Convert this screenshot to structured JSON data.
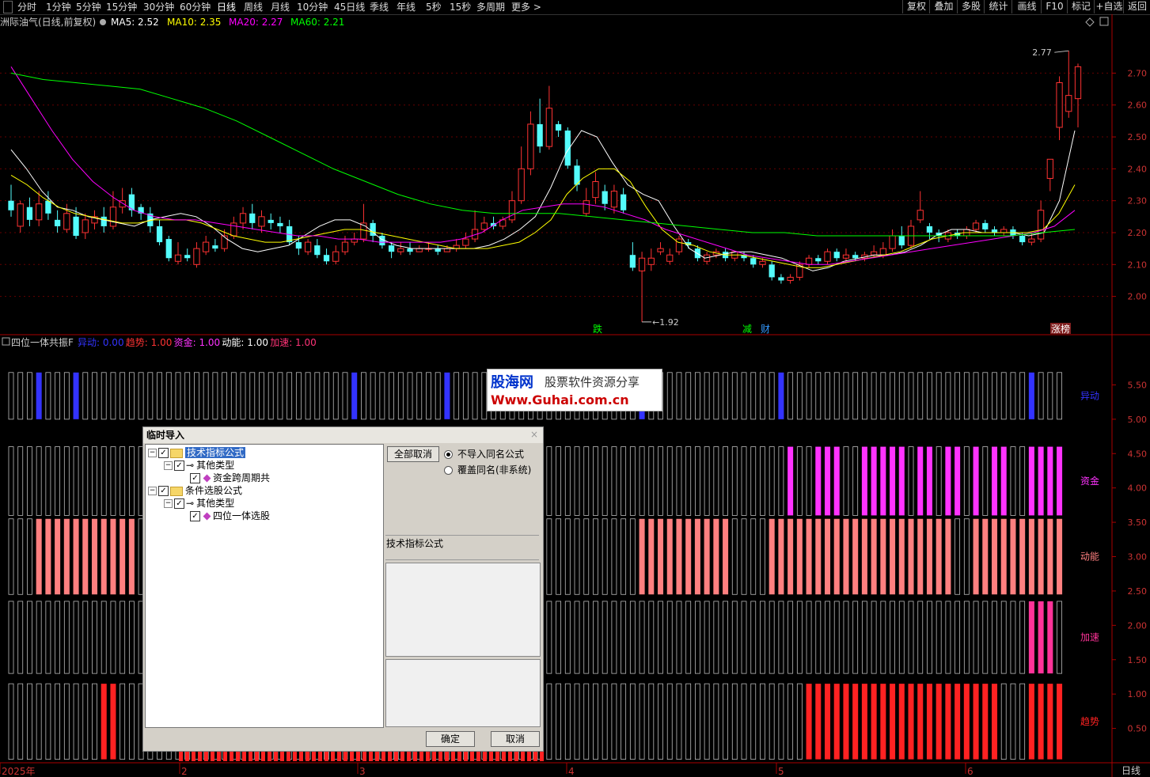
{
  "toolbar": {
    "periods": [
      "分时",
      "1分钟",
      "5分钟",
      "15分钟",
      "30分钟",
      "60分钟",
      "日线",
      "周线",
      "月线",
      "10分钟",
      "45日线",
      "季线",
      "年线",
      "5秒",
      "15秒",
      "多周期",
      "更多 >"
    ],
    "active_period": "日线",
    "right_buttons": [
      "复权",
      "叠加",
      "多股",
      "统计",
      "画线",
      "F10",
      "标记",
      "+自选",
      "返回"
    ]
  },
  "main_chart": {
    "title": "洲际油气(日线,前复权)",
    "ma_legend": [
      {
        "label": "MA5: 2.52",
        "color": "#ffffff"
      },
      {
        "label": "MA10: 2.35",
        "color": "#ffff00"
      },
      {
        "label": "MA20: 2.27",
        "color": "#ff00ff"
      },
      {
        "label": "MA60: 2.21",
        "color": "#00ff00"
      }
    ],
    "high_label": "2.77",
    "low_label": "1.92",
    "markers": [
      {
        "text": "跌",
        "color": "#00ff00"
      },
      {
        "text": "减",
        "color": "#00ff00"
      },
      {
        "text": "财",
        "color": "#3399ff"
      },
      {
        "text": "涨榜",
        "color": "#ffffff"
      }
    ]
  },
  "indicator_panel": {
    "title": "四位一体共振F",
    "legend": [
      {
        "label": "异动: 0.00",
        "color": "#3333ff"
      },
      {
        "label": "趋势: 1.00",
        "color": "#ff3333"
      },
      {
        "label": "资金: 1.00",
        "color": "#ff33ff"
      },
      {
        "label": "动能: 1.00",
        "color": "#ffffff"
      },
      {
        "label": "加速: 1.00",
        "color": "#ff3377"
      }
    ],
    "band_labels": [
      "异动",
      "资金",
      "动能",
      "加速",
      "趋势"
    ],
    "band_colors": [
      "#3333ff",
      "#ff33ff",
      "#ff8080",
      "#ff3399",
      "#ff2222"
    ]
  },
  "x_axis": {
    "labels": [
      "2025年",
      "2",
      "3",
      "4",
      "5",
      "6"
    ],
    "period_label": "日线"
  },
  "chart_data": {
    "type": "candlestick",
    "price_axis": {
      "ticks": [
        "2.70",
        "2.60",
        "2.50",
        "2.40",
        "2.30",
        "2.20",
        "2.10",
        "2.00"
      ],
      "ylim": [
        1.88,
        2.83
      ]
    },
    "indicator_axis": {
      "ticks": [
        "5.50",
        "5.00",
        "4.50",
        "4.00",
        "3.50",
        "3.00",
        "2.50",
        "2.00",
        "1.50",
        "1.00",
        "0.50"
      ],
      "ylim": [
        0,
        6.0
      ]
    },
    "candles": [
      [
        2.3,
        2.27,
        2.35,
        2.25
      ],
      [
        2.22,
        2.29,
        2.3,
        2.2
      ],
      [
        2.28,
        2.24,
        2.31,
        2.22
      ],
      [
        2.24,
        2.29,
        2.33,
        2.22
      ],
      [
        2.3,
        2.26,
        2.33,
        2.24
      ],
      [
        2.24,
        2.22,
        2.27,
        2.2
      ],
      [
        2.21,
        2.26,
        2.29,
        2.2
      ],
      [
        2.25,
        2.19,
        2.28,
        2.18
      ],
      [
        2.2,
        2.24,
        2.26,
        2.18
      ],
      [
        2.23,
        2.25,
        2.27,
        2.21
      ],
      [
        2.25,
        2.22,
        2.28,
        2.2
      ],
      [
        2.22,
        2.28,
        2.33,
        2.21
      ],
      [
        2.28,
        2.3,
        2.34,
        2.26
      ],
      [
        2.32,
        2.27,
        2.34,
        2.25
      ],
      [
        2.28,
        2.26,
        2.29,
        2.24
      ],
      [
        2.26,
        2.22,
        2.28,
        2.2
      ],
      [
        2.22,
        2.17,
        2.24,
        2.16
      ],
      [
        2.18,
        2.12,
        2.19,
        2.11
      ],
      [
        2.11,
        2.13,
        2.17,
        2.1
      ],
      [
        2.13,
        2.12,
        2.15,
        2.11
      ],
      [
        2.1,
        2.15,
        2.17,
        2.09
      ],
      [
        2.14,
        2.17,
        2.19,
        2.13
      ],
      [
        2.16,
        2.15,
        2.18,
        2.14
      ],
      [
        2.15,
        2.19,
        2.21,
        2.14
      ],
      [
        2.19,
        2.23,
        2.25,
        2.18
      ],
      [
        2.23,
        2.26,
        2.28,
        2.21
      ],
      [
        2.26,
        2.23,
        2.29,
        2.21
      ],
      [
        2.22,
        2.25,
        2.27,
        2.2
      ],
      [
        2.24,
        2.23,
        2.26,
        2.21
      ],
      [
        2.23,
        2.22,
        2.25,
        2.2
      ],
      [
        2.22,
        2.17,
        2.24,
        2.16
      ],
      [
        2.17,
        2.15,
        2.19,
        2.13
      ],
      [
        2.14,
        2.17,
        2.18,
        2.13
      ],
      [
        2.16,
        2.13,
        2.18,
        2.12
      ],
      [
        2.13,
        2.11,
        2.15,
        2.1
      ],
      [
        2.11,
        2.14,
        2.16,
        2.1
      ],
      [
        2.14,
        2.17,
        2.19,
        2.13
      ],
      [
        2.17,
        2.18,
        2.2,
        2.16
      ],
      [
        2.18,
        2.23,
        2.29,
        2.17
      ],
      [
        2.23,
        2.19,
        2.24,
        2.17
      ],
      [
        2.19,
        2.16,
        2.2,
        2.15
      ],
      [
        2.16,
        2.14,
        2.17,
        2.12
      ],
      [
        2.14,
        2.15,
        2.17,
        2.13
      ],
      [
        2.15,
        2.14,
        2.17,
        2.13
      ],
      [
        2.14,
        2.15,
        2.16,
        2.14
      ],
      [
        2.15,
        2.15,
        2.17,
        2.14
      ],
      [
        2.15,
        2.14,
        2.16,
        2.13
      ],
      [
        2.14,
        2.15,
        2.16,
        2.14
      ],
      [
        2.15,
        2.16,
        2.18,
        2.14
      ],
      [
        2.16,
        2.18,
        2.2,
        2.15
      ],
      [
        2.18,
        2.21,
        2.27,
        2.17
      ],
      [
        2.21,
        2.23,
        2.25,
        2.2
      ],
      [
        2.23,
        2.22,
        2.25,
        2.21
      ],
      [
        2.22,
        2.24,
        2.25,
        2.21
      ],
      [
        2.24,
        2.3,
        2.33,
        2.23
      ],
      [
        2.3,
        2.4,
        2.47,
        2.29
      ],
      [
        2.4,
        2.54,
        2.58,
        2.38
      ],
      [
        2.54,
        2.47,
        2.62,
        2.45
      ],
      [
        2.47,
        2.59,
        2.66,
        2.46
      ],
      [
        2.54,
        2.52,
        2.55,
        2.5
      ],
      [
        2.52,
        2.41,
        2.53,
        2.4
      ],
      [
        2.41,
        2.35,
        2.43,
        2.33
      ],
      [
        2.26,
        2.3,
        2.34,
        2.25
      ],
      [
        2.31,
        2.36,
        2.39,
        2.29
      ],
      [
        2.33,
        2.29,
        2.35,
        2.27
      ],
      [
        2.28,
        2.33,
        2.35,
        2.26
      ],
      [
        2.32,
        2.27,
        2.34,
        2.26
      ],
      [
        2.13,
        2.09,
        2.17,
        2.08
      ],
      [
        2.08,
        2.12,
        2.14,
        1.92
      ],
      [
        2.1,
        2.12,
        2.15,
        2.08
      ],
      [
        2.14,
        2.15,
        2.17,
        2.13
      ],
      [
        2.11,
        2.13,
        2.15,
        2.1
      ],
      [
        2.14,
        2.18,
        2.19,
        2.13
      ],
      [
        2.17,
        2.16,
        2.18,
        2.15
      ],
      [
        2.15,
        2.12,
        2.16,
        2.11
      ],
      [
        2.11,
        2.13,
        2.14,
        2.1
      ],
      [
        2.13,
        2.14,
        2.15,
        2.12
      ],
      [
        2.14,
        2.12,
        2.15,
        2.11
      ],
      [
        2.12,
        2.14,
        2.14,
        2.11
      ],
      [
        2.13,
        2.12,
        2.14,
        2.11
      ],
      [
        2.12,
        2.1,
        2.13,
        2.09
      ],
      [
        2.1,
        2.11,
        2.12,
        2.09
      ],
      [
        2.1,
        2.06,
        2.11,
        2.05
      ],
      [
        2.06,
        2.05,
        2.07,
        2.04
      ],
      [
        2.05,
        2.06,
        2.07,
        2.04
      ],
      [
        2.06,
        2.1,
        2.11,
        2.05
      ],
      [
        2.1,
        2.12,
        2.13,
        2.09
      ],
      [
        2.12,
        2.11,
        2.13,
        2.1
      ],
      [
        2.11,
        2.14,
        2.15,
        2.1
      ],
      [
        2.14,
        2.12,
        2.15,
        2.11
      ],
      [
        2.12,
        2.13,
        2.15,
        2.11
      ],
      [
        2.13,
        2.12,
        2.14,
        2.11
      ],
      [
        2.12,
        2.13,
        2.14,
        2.11
      ],
      [
        2.13,
        2.14,
        2.16,
        2.12
      ],
      [
        2.13,
        2.15,
        2.17,
        2.12
      ],
      [
        2.15,
        2.19,
        2.21,
        2.14
      ],
      [
        2.19,
        2.16,
        2.22,
        2.15
      ],
      [
        2.16,
        2.22,
        2.24,
        2.15
      ],
      [
        2.24,
        2.27,
        2.33,
        2.23
      ],
      [
        2.22,
        2.2,
        2.23,
        2.18
      ],
      [
        2.2,
        2.19,
        2.21,
        2.17
      ],
      [
        2.18,
        2.2,
        2.21,
        2.17
      ],
      [
        2.2,
        2.19,
        2.21,
        2.18
      ],
      [
        2.19,
        2.21,
        2.22,
        2.18
      ],
      [
        2.21,
        2.23,
        2.24,
        2.2
      ],
      [
        2.23,
        2.21,
        2.24,
        2.2
      ],
      [
        2.21,
        2.2,
        2.22,
        2.19
      ],
      [
        2.2,
        2.21,
        2.22,
        2.19
      ],
      [
        2.21,
        2.19,
        2.22,
        2.18
      ],
      [
        2.19,
        2.17,
        2.2,
        2.16
      ],
      [
        2.17,
        2.18,
        2.2,
        2.16
      ],
      [
        2.18,
        2.27,
        2.3,
        2.17
      ],
      [
        2.37,
        2.43,
        2.43,
        2.33
      ],
      [
        2.53,
        2.67,
        2.69,
        2.49
      ],
      [
        2.58,
        2.63,
        2.77,
        2.56
      ],
      [
        2.62,
        2.72,
        2.73,
        2.53
      ]
    ],
    "ma_series": [
      {
        "name": "MA5",
        "color": "#ffffff",
        "start": 0,
        "end": 2.52,
        "path": [
          2.46,
          2.4,
          2.33,
          2.28,
          2.27,
          2.25,
          2.24,
          2.23,
          2.22,
          2.24,
          2.25,
          2.26,
          2.25,
          2.22,
          2.18,
          2.15,
          2.14,
          2.15,
          2.16,
          2.19,
          2.22,
          2.24,
          2.24,
          2.22,
          2.18,
          2.16,
          2.15,
          2.15,
          2.15,
          2.15,
          2.15,
          2.16,
          2.18,
          2.21,
          2.25,
          2.34,
          2.45,
          2.52,
          2.5,
          2.42,
          2.35,
          2.32,
          2.3,
          2.22,
          2.15,
          2.12,
          2.13,
          2.14,
          2.14,
          2.13,
          2.12,
          2.1,
          2.08,
          2.09,
          2.11,
          2.12,
          2.13,
          2.13,
          2.14,
          2.16,
          2.19,
          2.21,
          2.21,
          2.2,
          2.2,
          2.2,
          2.19,
          2.2,
          2.3,
          2.52
        ]
      },
      {
        "name": "MA10",
        "color": "#ffff00",
        "start": 0,
        "end": 2.35,
        "path": [
          2.38,
          2.35,
          2.31,
          2.28,
          2.26,
          2.25,
          2.24,
          2.23,
          2.23,
          2.24,
          2.24,
          2.24,
          2.23,
          2.21,
          2.19,
          2.18,
          2.17,
          2.17,
          2.18,
          2.19,
          2.2,
          2.21,
          2.21,
          2.2,
          2.19,
          2.18,
          2.17,
          2.16,
          2.15,
          2.15,
          2.15,
          2.16,
          2.17,
          2.2,
          2.24,
          2.32,
          2.37,
          2.4,
          2.4,
          2.36,
          2.28,
          2.21,
          2.17,
          2.16,
          2.14,
          2.13,
          2.13,
          2.12,
          2.11,
          2.1,
          2.09,
          2.09,
          2.1,
          2.11,
          2.12,
          2.13,
          2.14,
          2.16,
          2.18,
          2.19,
          2.2,
          2.2,
          2.2,
          2.2,
          2.2,
          2.21,
          2.26,
          2.35
        ]
      },
      {
        "name": "MA20",
        "color": "#ff00ff",
        "start": 0,
        "end": 2.27,
        "path": [
          2.72,
          2.62,
          2.52,
          2.43,
          2.36,
          2.31,
          2.27,
          2.25,
          2.24,
          2.24,
          2.23,
          2.22,
          2.21,
          2.2,
          2.19,
          2.19,
          2.18,
          2.18,
          2.17,
          2.17,
          2.17,
          2.17,
          2.18,
          2.2,
          2.24,
          2.27,
          2.28,
          2.29,
          2.29,
          2.28,
          2.26,
          2.24,
          2.21,
          2.19,
          2.17,
          2.15,
          2.13,
          2.12,
          2.11,
          2.1,
          2.1,
          2.11,
          2.12,
          2.13,
          2.14,
          2.15,
          2.16,
          2.17,
          2.18,
          2.19,
          2.2,
          2.22,
          2.27
        ]
      },
      {
        "name": "MA60",
        "color": "#00ff00",
        "start": 0,
        "end": 2.21,
        "path": [
          2.7,
          2.68,
          2.67,
          2.66,
          2.65,
          2.62,
          2.59,
          2.55,
          2.5,
          2.45,
          2.4,
          2.36,
          2.32,
          2.29,
          2.27,
          2.26,
          2.26,
          2.26,
          2.25,
          2.24,
          2.23,
          2.22,
          2.21,
          2.2,
          2.2,
          2.19,
          2.19,
          2.19,
          2.19,
          2.19,
          2.19,
          2.19,
          2.2,
          2.21
        ]
      }
    ],
    "bands": {
      "yidong": [
        5.0,
        5.68
      ],
      "zijin": [
        3.6,
        4.6
      ],
      "dongneng": [
        2.45,
        3.55
      ],
      "jiasu": [
        1.3,
        2.35
      ],
      "qushi": [
        0.05,
        1.15
      ]
    }
  },
  "dialog": {
    "title": "临时导入",
    "close": "×",
    "tree": [
      {
        "level": 0,
        "label": "技术指标公式",
        "type": "folder",
        "selected": true
      },
      {
        "level": 1,
        "label": "其他类型",
        "type": "key"
      },
      {
        "level": 2,
        "label": "资金跨周期共",
        "type": "item"
      },
      {
        "level": 0,
        "label": "条件选股公式",
        "type": "folder"
      },
      {
        "level": 1,
        "label": "其他类型",
        "type": "key"
      },
      {
        "level": 2,
        "label": "四位一体选股",
        "type": "item"
      }
    ],
    "cancel_all": "全部取消",
    "radio_options": [
      "不导入同名公式",
      "覆盖同名(非系统)"
    ],
    "panel_label": "技术指标公式",
    "ok": "确定",
    "cancel": "取消"
  },
  "watermark": {
    "line1": "股海网",
    "line2": "股票软件资源分享",
    "line3": "Www.Guhai.com.cn"
  }
}
